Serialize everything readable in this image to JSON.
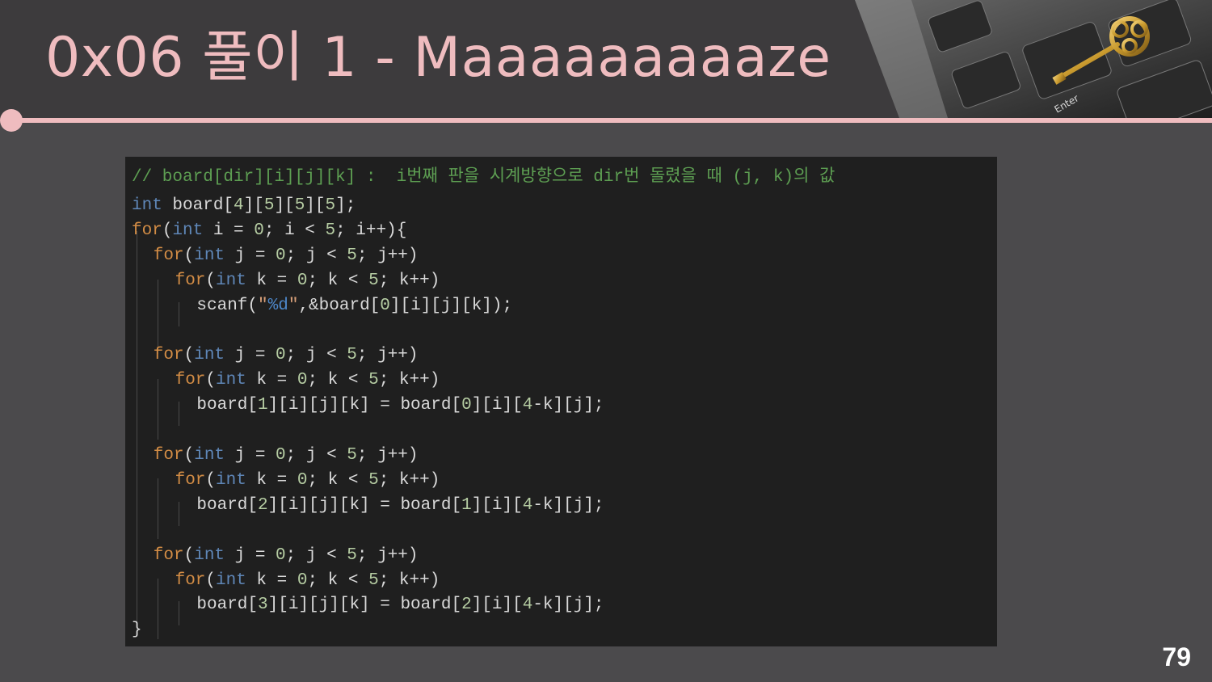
{
  "slide": {
    "title": "0x06  풀이 1 - Maaaaaaaaaze",
    "page_number": "79",
    "header_image": "keyboard-with-key-photo",
    "colors": {
      "accent": "#efbcbf",
      "header_bg": "#3d3b3d",
      "body_bg": "#4b4a4c",
      "code_bg": "#1f1f1f"
    }
  },
  "code": {
    "comment": "// board[dir][i][j][k] :  i번째 판을 시계방향으로 dir번 돌렸을 때 (j, k)의 값",
    "lines": [
      "int board[4][5][5][5];",
      "for(int i = 0; i < 5; i++){",
      "  for(int j = 0; j < 5; j++)",
      "    for(int k = 0; k < 5; k++)",
      "      scanf(\"%d\",&board[0][i][j][k]);",
      "",
      "  for(int j = 0; j < 5; j++)",
      "    for(int k = 0; k < 5; k++)",
      "      board[1][i][j][k] = board[0][i][4-k][j];",
      "",
      "  for(int j = 0; j < 5; j++)",
      "    for(int k = 0; k < 5; k++)",
      "      board[2][i][j][k] = board[1][i][4-k][j];",
      "",
      "  for(int j = 0; j < 5; j++)",
      "    for(int k = 0; k < 5; k++)",
      "      board[3][i][j][k] = board[2][i][4-k][j];",
      "}"
    ]
  }
}
